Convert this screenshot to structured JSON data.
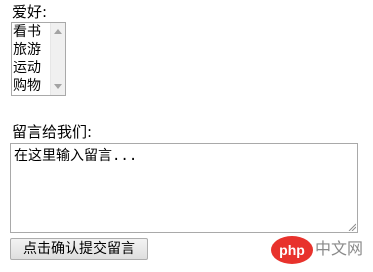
{
  "hobby": {
    "label": "爱好:",
    "options": [
      "看书",
      "旅游",
      "运动",
      "购物"
    ]
  },
  "message": {
    "label": "留言给我们:",
    "value": "在这里输入留言..."
  },
  "submit": {
    "label": "点击确认提交留言"
  },
  "watermark": {
    "logo_text": "php",
    "site_text": "中文网",
    "logo_color": "#e8322c"
  }
}
